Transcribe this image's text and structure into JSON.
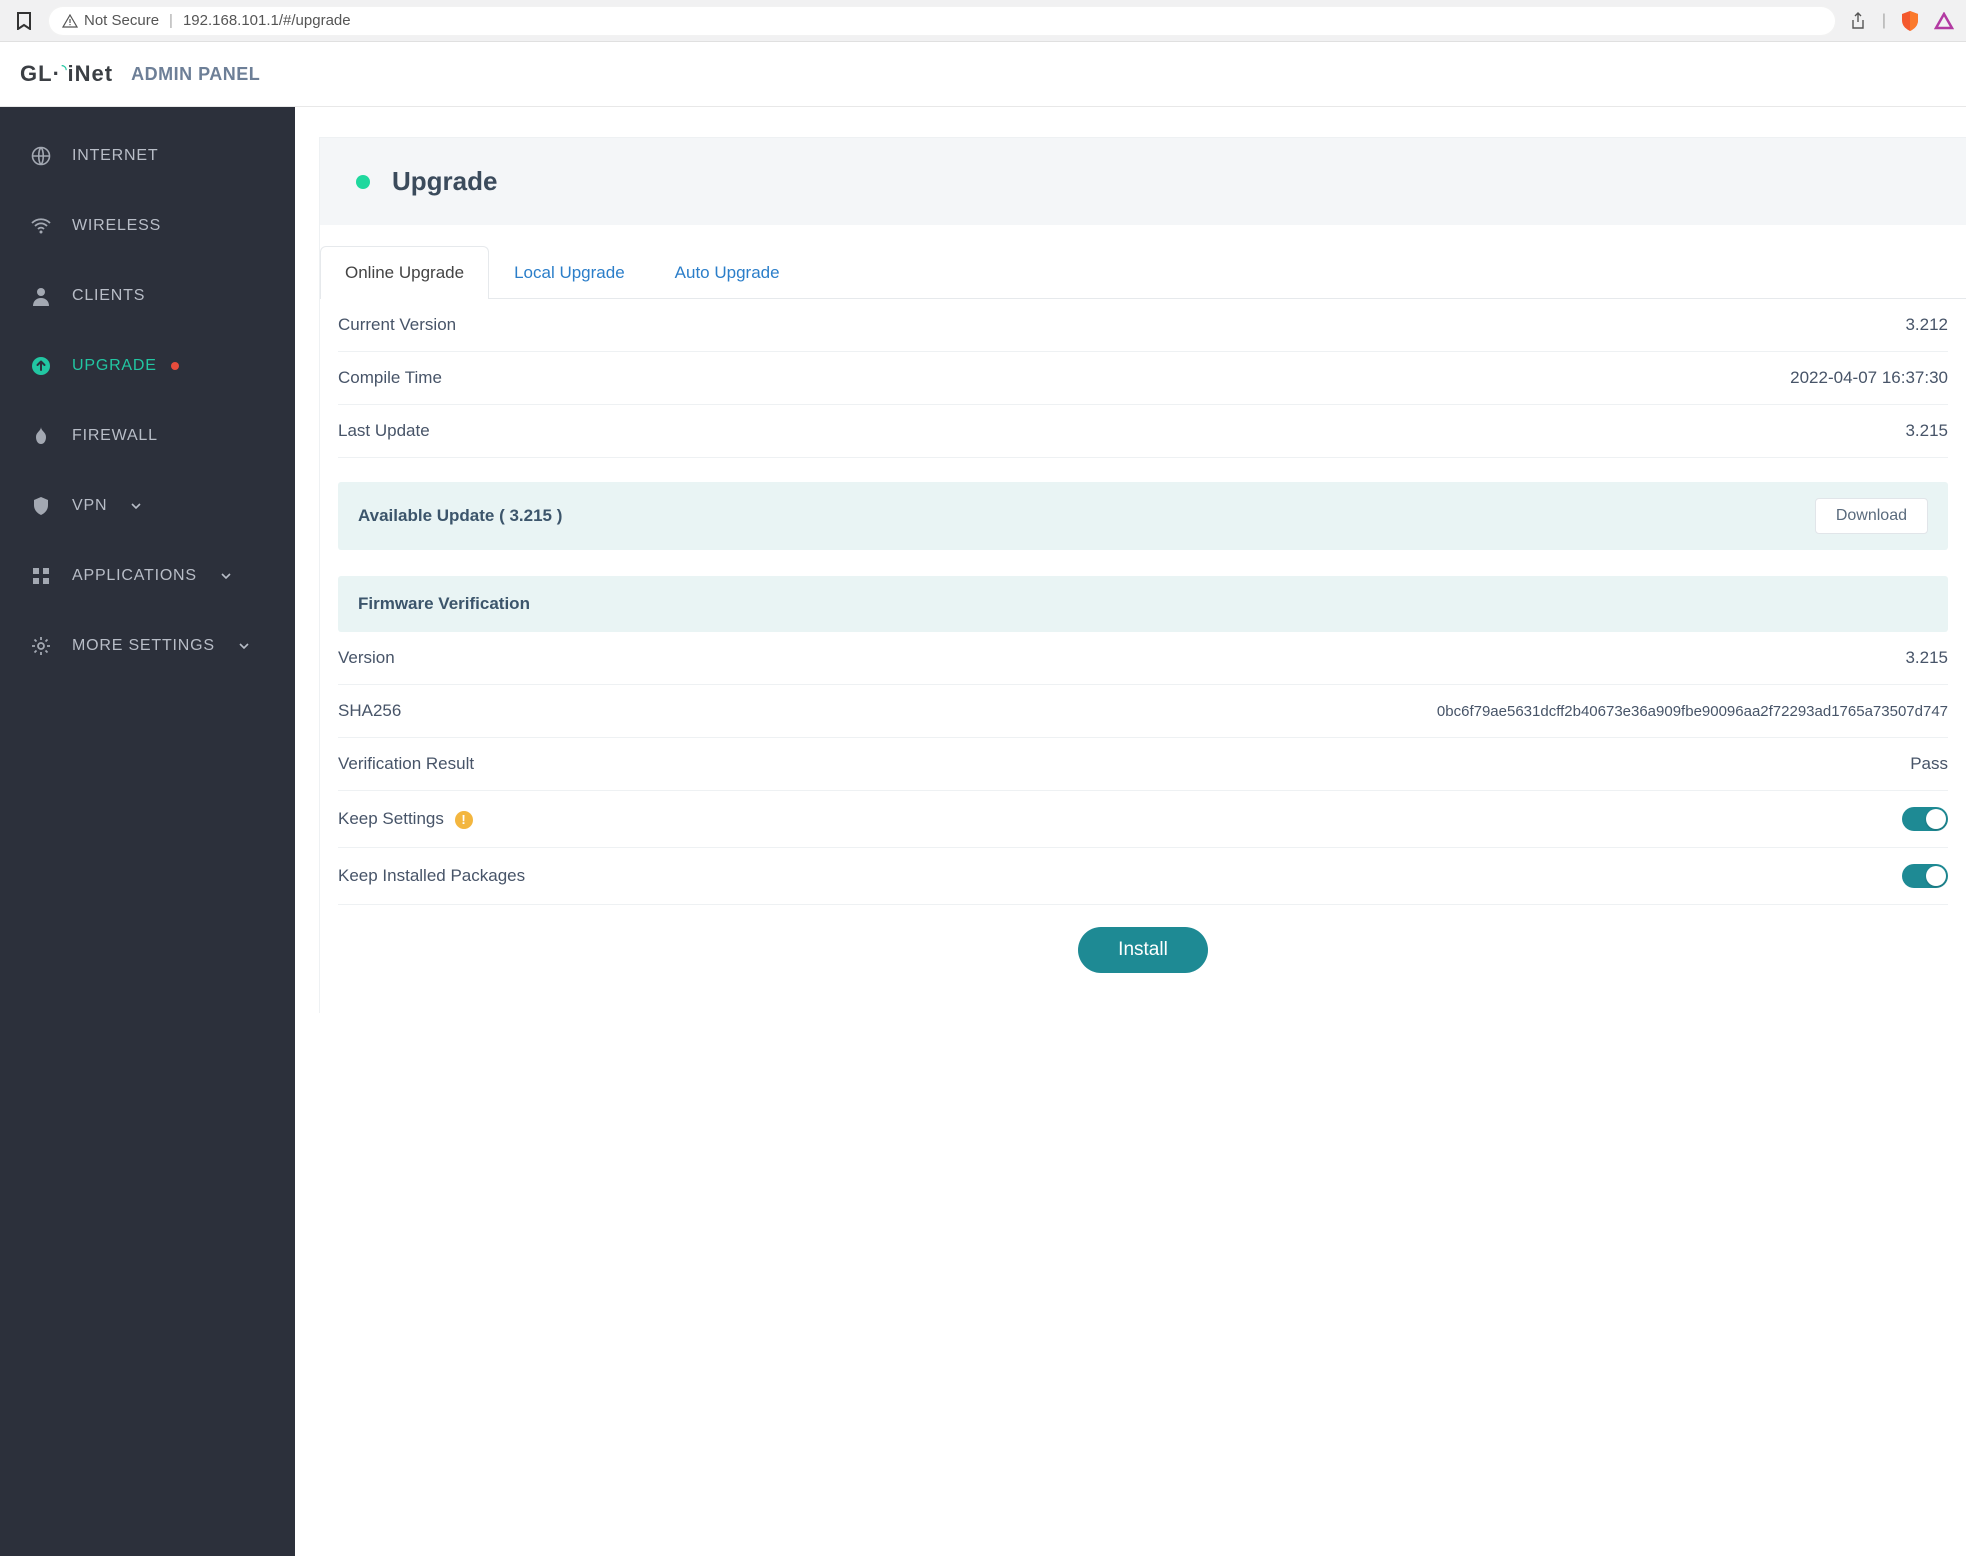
{
  "browser": {
    "not_secure": "Not Secure",
    "url": "192.168.101.1/#/upgrade"
  },
  "header": {
    "brand_prefix": "GL",
    "brand_suffix": "iNet",
    "title": "ADMIN PANEL"
  },
  "sidebar": {
    "items": [
      {
        "label": "INTERNET"
      },
      {
        "label": "WIRELESS"
      },
      {
        "label": "CLIENTS"
      },
      {
        "label": "UPGRADE"
      },
      {
        "label": "FIREWALL"
      },
      {
        "label": "VPN"
      },
      {
        "label": "APPLICATIONS"
      },
      {
        "label": "MORE SETTINGS"
      }
    ]
  },
  "page": {
    "title": "Upgrade",
    "tabs": [
      {
        "label": "Online Upgrade"
      },
      {
        "label": "Local Upgrade"
      },
      {
        "label": "Auto Upgrade"
      }
    ],
    "current_version_label": "Current Version",
    "current_version_value": "3.212",
    "compile_time_label": "Compile Time",
    "compile_time_value": "2022-04-07 16:37:30",
    "last_update_label": "Last Update",
    "last_update_value": "3.215",
    "available": {
      "label": "Available Update ( 3.215 )",
      "download": "Download"
    },
    "verification": {
      "heading": "Firmware Verification",
      "version_label": "Version",
      "version_value": "3.215",
      "sha_label": "SHA256",
      "sha_value": "0bc6f79ae5631dcff2b40673e36a909fbe90096aa2f72293ad1765a73507d747",
      "result_label": "Verification Result",
      "result_value": "Pass",
      "keep_settings_label": "Keep Settings",
      "keep_packages_label": "Keep Installed Packages"
    },
    "install": "Install"
  }
}
